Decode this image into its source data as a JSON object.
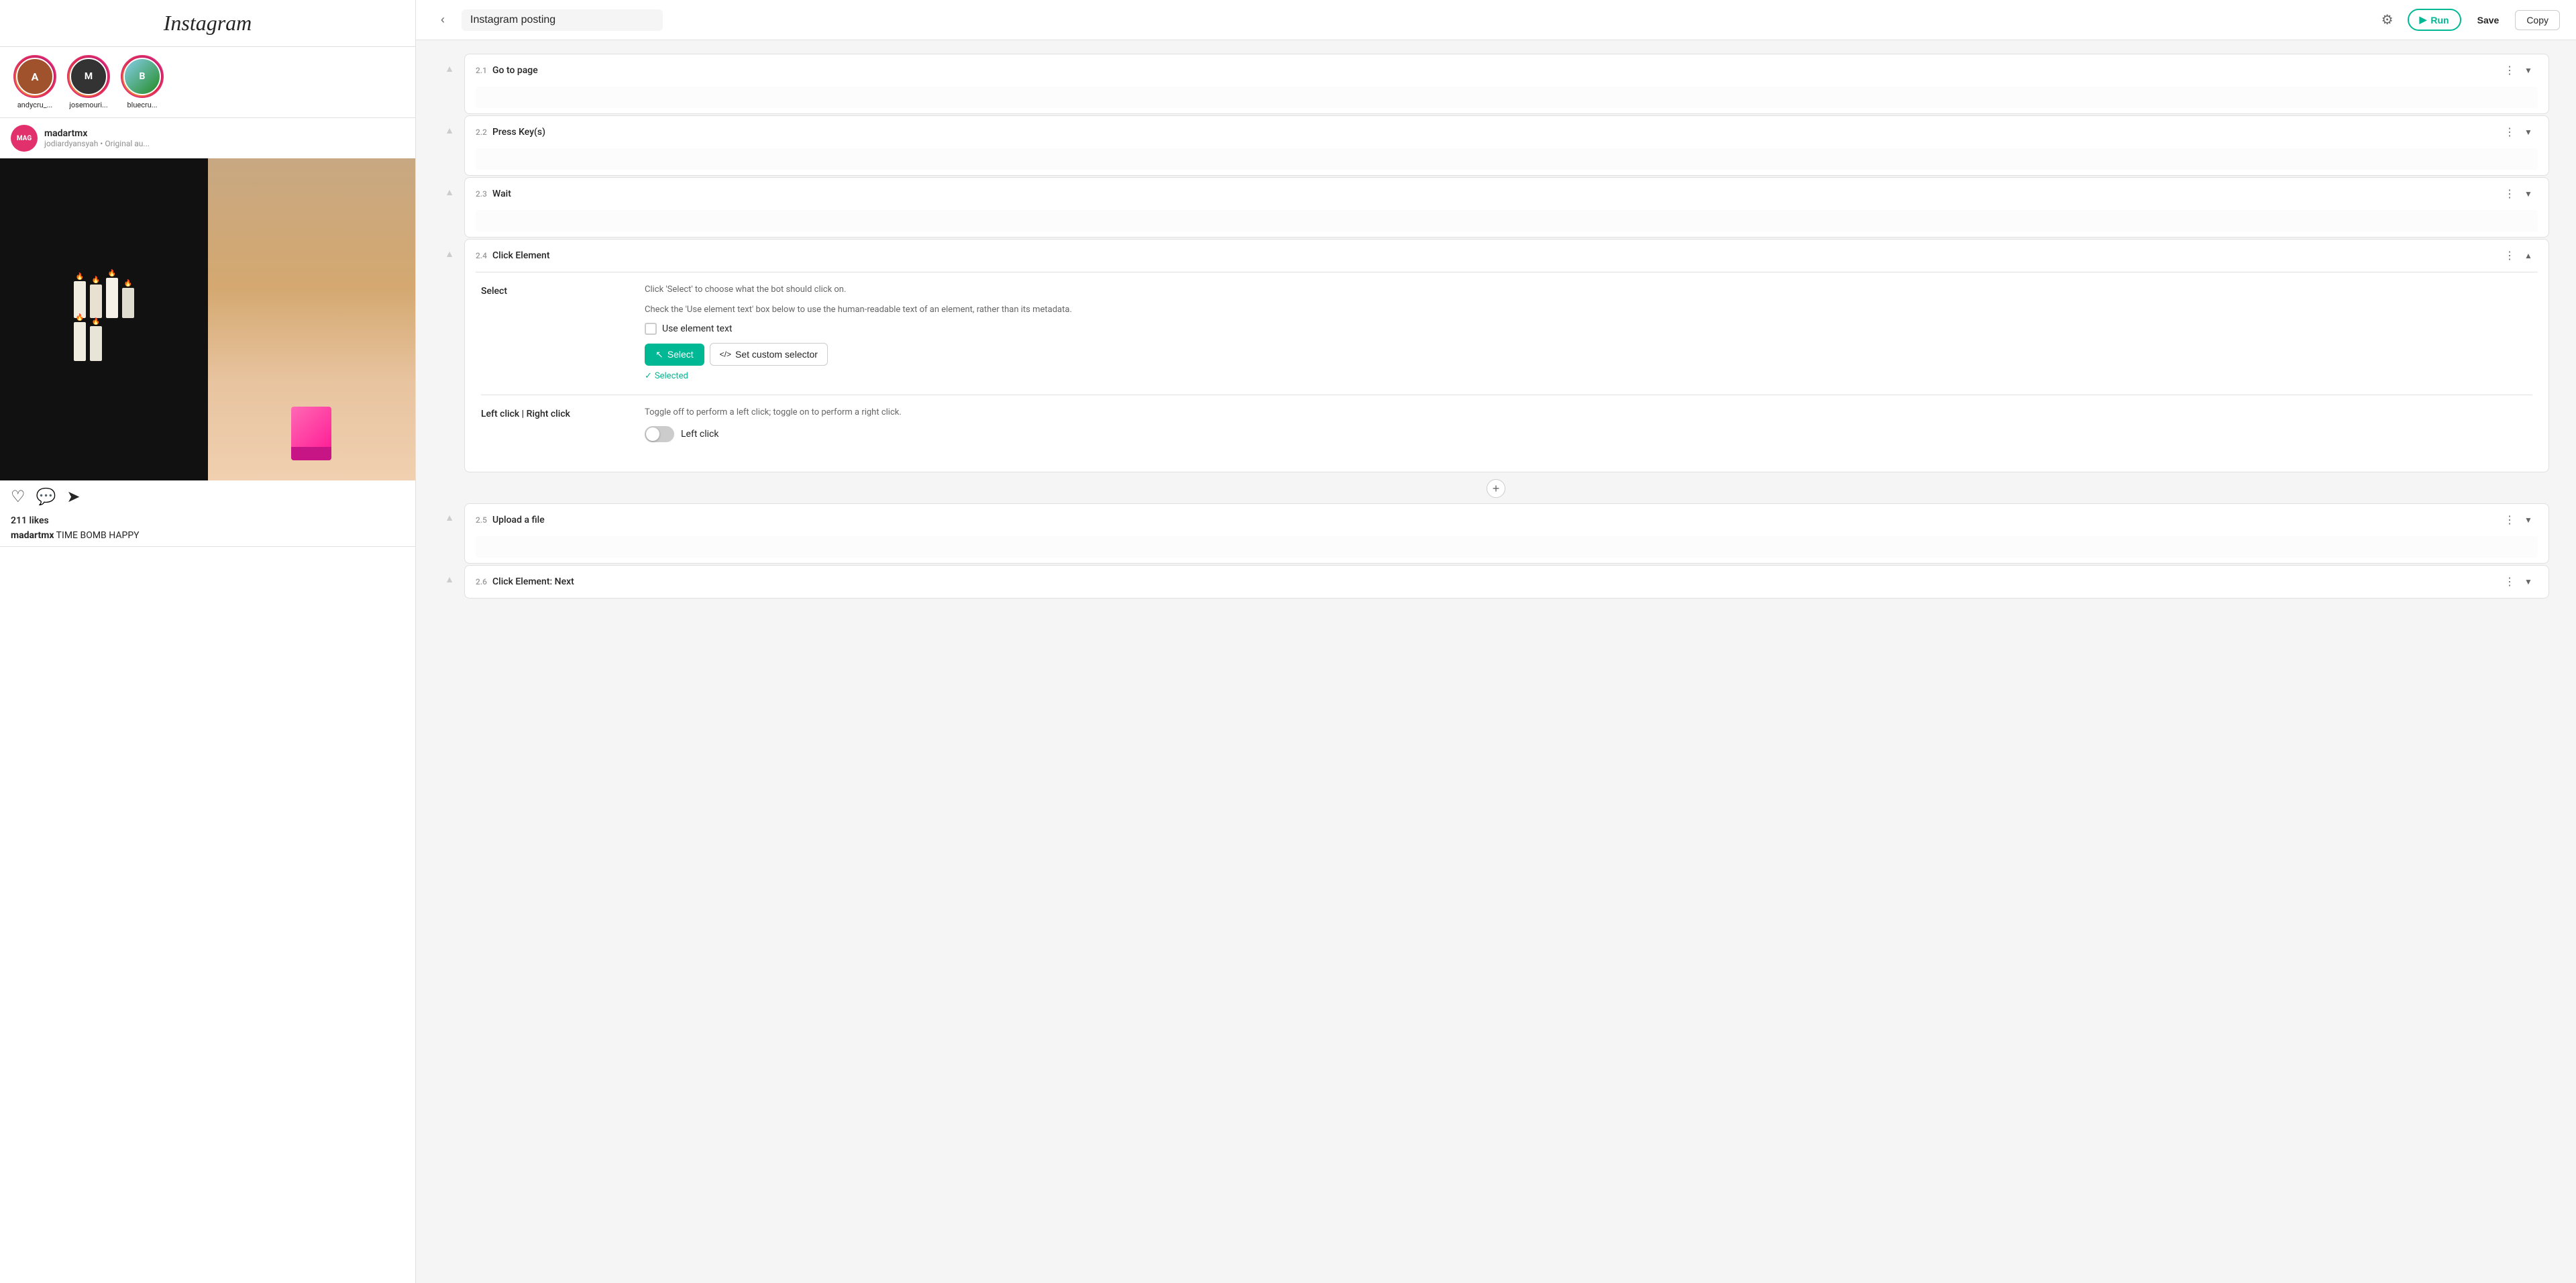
{
  "app": {
    "name": "Instagram"
  },
  "left_panel": {
    "stories": [
      {
        "id": "user1",
        "username": "andycru_...",
        "color_class": "user1",
        "initial": "A"
      },
      {
        "id": "user2",
        "username": "josemouri...",
        "color_class": "user2",
        "initial": "M"
      },
      {
        "id": "user3",
        "username": "bluecru...",
        "color_class": "user3",
        "initial": "B"
      }
    ],
    "post": {
      "username": "madartmx",
      "subtitle": "jodiardyansyah • Original au...",
      "initial": "MAG",
      "likes": "211 likes",
      "caption_username": "madartmx",
      "caption_text": "TIME BOMB HAPPY"
    }
  },
  "top_bar": {
    "workflow_title": "Instagram posting",
    "run_label": "Run",
    "save_label": "Save",
    "copy_label": "Copy"
  },
  "steps": [
    {
      "id": "2.1",
      "title": "Go to page",
      "expanded": false
    },
    {
      "id": "2.2",
      "title": "Press Key(s)",
      "expanded": false
    },
    {
      "id": "2.3",
      "title": "Wait",
      "expanded": false
    },
    {
      "id": "2.4",
      "title": "Click Element",
      "expanded": true,
      "fields": {
        "select": {
          "label": "Select",
          "description_line1": "Click 'Select' to choose what the bot should click on.",
          "description_line2": "Check the 'Use element text' box below to use the human-readable text of an element, rather than its metadata.",
          "checkbox_label": "Use element text",
          "select_btn_label": "Select",
          "custom_selector_label": "Set custom selector",
          "selected_text": "Selected"
        },
        "click_type": {
          "label": "Left click | Right click",
          "description": "Toggle off to perform a left click; toggle on to perform a right click.",
          "toggle_label": "Left click"
        }
      }
    },
    {
      "id": "2.5",
      "title": "Upload a file",
      "expanded": false
    },
    {
      "id": "2.6",
      "title": "Click Element: Next",
      "expanded": false
    }
  ]
}
